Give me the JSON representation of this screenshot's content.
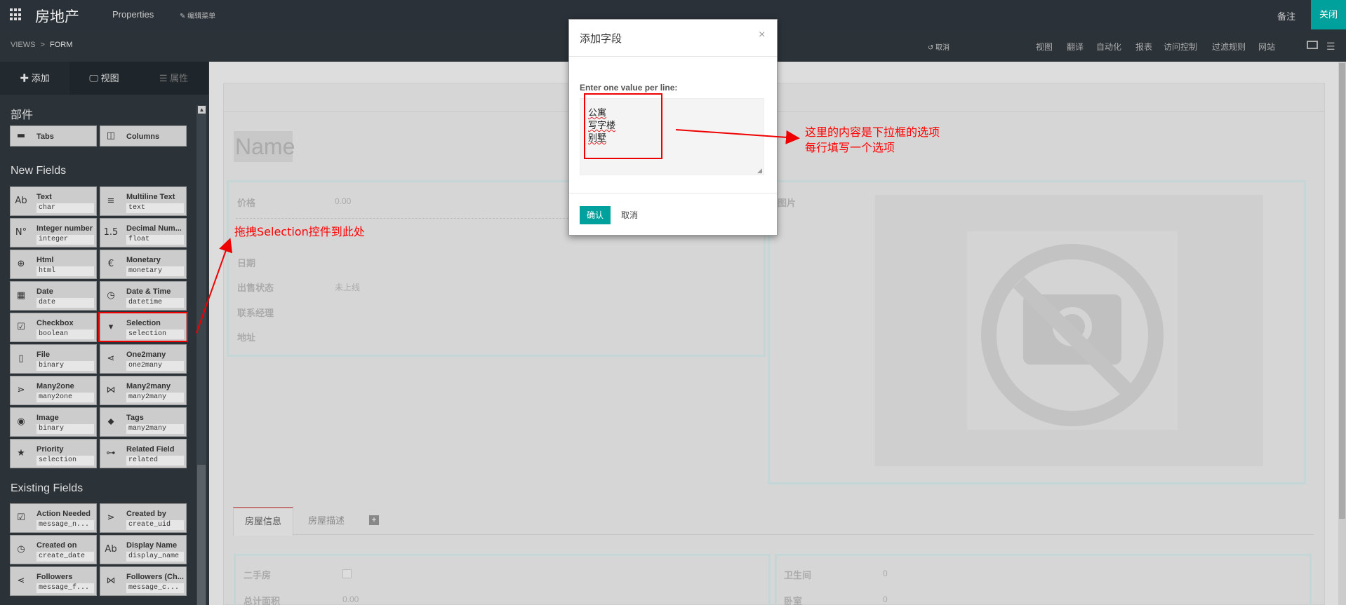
{
  "topbar": {
    "app_title": "房地产",
    "menu_properties": "Properties",
    "menu_edit": "✎ 编辑菜单",
    "note": "备注",
    "close": "关闭"
  },
  "subbar": {
    "crumb_views": "VIEWS",
    "crumb_sep": ">",
    "crumb_form": "FORM",
    "undo": "↺ 取消",
    "links": [
      "视图",
      "翻译",
      "自动化",
      "报表",
      "访问控制",
      "过滤规则",
      "网站"
    ]
  },
  "sidebar": {
    "tabs": [
      "✚ 添加",
      "🖵 视图",
      "☰ 属性"
    ],
    "sec_widgets": "部件",
    "widgets": [
      {
        "icon": "▬",
        "label": "Tabs"
      },
      {
        "icon": "◫",
        "label": "Columns"
      }
    ],
    "sec_new": "New Fields",
    "new_fields": [
      {
        "icon": "Ab",
        "label": "Text",
        "tech": "char"
      },
      {
        "icon": "≡",
        "label": "Multiline Text",
        "tech": "text"
      },
      {
        "icon": "N°",
        "label": "Integer number",
        "tech": "integer"
      },
      {
        "icon": "1.5",
        "label": "Decimal Num...",
        "tech": "float"
      },
      {
        "icon": "⊕",
        "label": "Html",
        "tech": "html"
      },
      {
        "icon": "€",
        "label": "Monetary",
        "tech": "monetary"
      },
      {
        "icon": "▦",
        "label": "Date",
        "tech": "date"
      },
      {
        "icon": "◷",
        "label": "Date & Time",
        "tech": "datetime"
      },
      {
        "icon": "☑",
        "label": "Checkbox",
        "tech": "boolean"
      },
      {
        "icon": "▾",
        "label": "Selection",
        "tech": "selection"
      },
      {
        "icon": "▯",
        "label": "File",
        "tech": "binary"
      },
      {
        "icon": "⋖",
        "label": "One2many",
        "tech": "one2many"
      },
      {
        "icon": "⋗",
        "label": "Many2one",
        "tech": "many2one"
      },
      {
        "icon": "⋈",
        "label": "Many2many",
        "tech": "many2many"
      },
      {
        "icon": "◉",
        "label": "Image",
        "tech": "binary"
      },
      {
        "icon": "⬥",
        "label": "Tags",
        "tech": "many2many"
      },
      {
        "icon": "★",
        "label": "Priority",
        "tech": "selection"
      },
      {
        "icon": "⊶",
        "label": "Related Field",
        "tech": "related"
      }
    ],
    "sec_existing": "Existing Fields",
    "existing_fields": [
      {
        "icon": "☑",
        "label": "Action Needed",
        "tech": "message_n..."
      },
      {
        "icon": "⋗",
        "label": "Created by",
        "tech": "create_uid"
      },
      {
        "icon": "◷",
        "label": "Created on",
        "tech": "create_date"
      },
      {
        "icon": "Ab",
        "label": "Display Name",
        "tech": "display_name"
      },
      {
        "icon": "⋖",
        "label": "Followers",
        "tech": "message_f..."
      },
      {
        "icon": "⋈",
        "label": "Followers (Ch...",
        "tech": "message_c..."
      }
    ]
  },
  "form": {
    "name_placeholder": "Name",
    "left_fields": [
      {
        "label": "价格",
        "value": "0.00"
      },
      {
        "label": "日期",
        "value": ""
      },
      {
        "label": "出售状态",
        "value": "未上线"
      },
      {
        "label": "联系经理",
        "value": ""
      },
      {
        "label": "地址",
        "value": ""
      }
    ],
    "image_label": "图片",
    "tabs": [
      "房屋信息",
      "房屋描述"
    ],
    "tab_add": "+",
    "bottom_left": [
      {
        "label": "二手房",
        "value": ""
      },
      {
        "label": "总计面积",
        "value": "0.00"
      }
    ],
    "bottom_right": [
      {
        "label": "卫生间",
        "value": "0"
      },
      {
        "label": "卧室",
        "value": "0"
      }
    ]
  },
  "modal": {
    "title": "添加字段",
    "close": "×",
    "label": "Enter one value per line:",
    "values": [
      "公寓",
      "写字楼",
      "别墅"
    ],
    "confirm": "确认",
    "cancel": "取消"
  },
  "annotations": {
    "drop_hint": "拖拽Selection控件到此处",
    "textarea_hint_1": "这里的内容是下拉框的选项",
    "textarea_hint_2": "每行填写一个选项"
  },
  "colors": {
    "accent": "#00a09d",
    "annotation_red": "#ee0000"
  }
}
